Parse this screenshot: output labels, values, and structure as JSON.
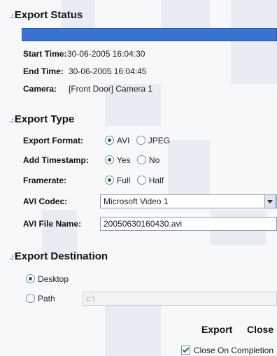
{
  "export_status": {
    "heading": "Export Status",
    "progress_fraction": 1.0,
    "start_label": "Start Time:",
    "start_value": "30-06-2005 16:04:30",
    "end_label": "End Time:",
    "end_value": "30-06-2005 16:04:45",
    "camera_label": "Camera:",
    "camera_value": "[Front Door] Camera 1"
  },
  "export_type": {
    "heading": "Export Type",
    "format_label": "Export Format:",
    "format_avi": "AVI",
    "format_jpeg": "JPEG",
    "timestamp_label": "Add Timestamp:",
    "timestamp_yes": "Yes",
    "timestamp_no": "No",
    "framerate_label": "Framerate:",
    "framerate_full": "Full",
    "framerate_half": "Half",
    "codec_label": "AVI Codec:",
    "codec_value": "Microsoft Video 1",
    "filename_label": "AVI File Name:",
    "filename_value": "20050630160430.avi"
  },
  "export_destination": {
    "heading": "Export Destination",
    "desktop_label": "Desktop",
    "path_label": "Path",
    "path_value": "c:\\"
  },
  "actions": {
    "export_label": "Export",
    "close_label": "Close",
    "close_on_completion_label": "Close On Completion"
  },
  "colors": {
    "accent": "#3b73d1",
    "section_dots": "#3d6fc2",
    "radio_selected": "#2a6a2a"
  }
}
